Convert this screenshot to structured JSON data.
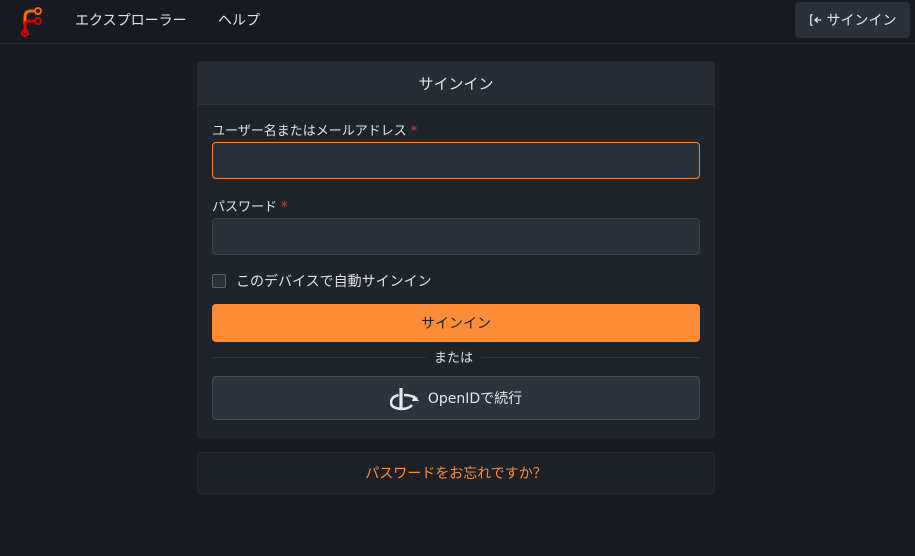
{
  "nav": {
    "explore": "エクスプローラー",
    "help": "ヘルプ",
    "signin": "サインイン"
  },
  "form": {
    "title": "サインイン",
    "username_label": "ユーザー名またはメールアドレス",
    "username_value": "",
    "password_label": "パスワード",
    "password_value": "",
    "required_mark": "*",
    "remember_label": "このデバイスで自動サインイン",
    "remember_checked": false,
    "submit_label": "サインイン",
    "or_text": "または",
    "openid_label": "OpenIDで続行"
  },
  "forgot": {
    "label": "パスワードをお忘れですか？"
  },
  "icons": {
    "logo": "forgejo-logo",
    "signin": "sign-in-icon",
    "openid": "openid-icon"
  },
  "colors": {
    "accent": "#ff8c38",
    "background": "#181c22",
    "required": "#e0403a"
  }
}
